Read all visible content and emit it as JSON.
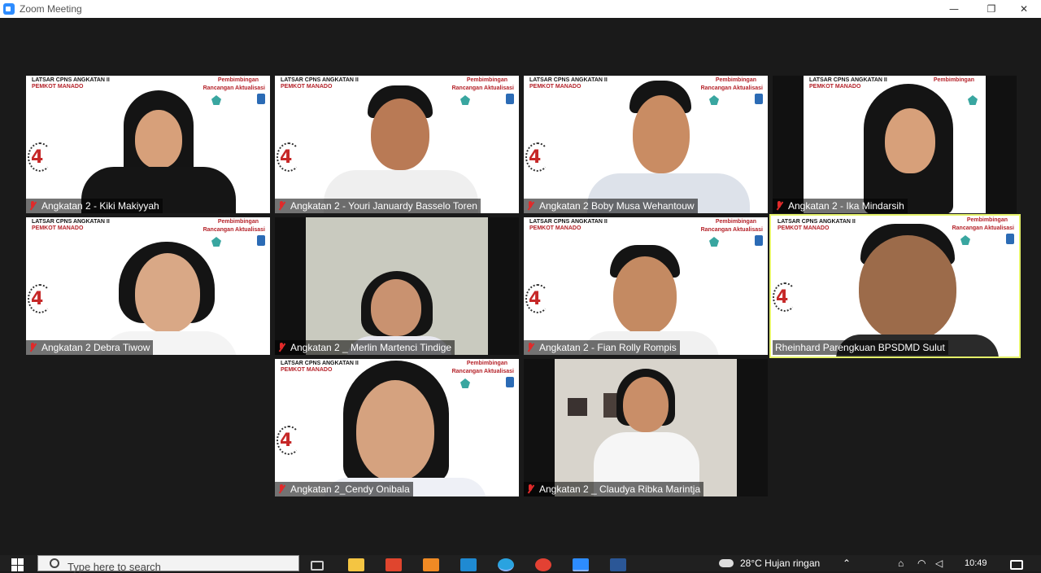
{
  "window": {
    "title": "Zoom Meeting",
    "minimize": "—",
    "maximize": "❐",
    "close": "✕"
  },
  "slide": {
    "header_line1": "LATSAR CPNS ANGKATAN II",
    "header_line2": "PEMKOT MANADO",
    "pembimbingan": "Pembimbingan",
    "rancangan": "Rancangan Aktualisasi",
    "number": "4"
  },
  "participants": [
    {
      "name": "Angkatan 2 - Kiki Makiyyah",
      "muted": true
    },
    {
      "name": "Angkatan 2 - Youri Januardy Basselo Toren",
      "muted": true
    },
    {
      "name": "Angkatan 2 Boby Musa Wehantouw",
      "muted": true
    },
    {
      "name": "Angkatan 2 - Ika Mindarsih",
      "muted": true
    },
    {
      "name": "Angkatan 2 Debra Tiwow",
      "muted": true
    },
    {
      "name": "Angkatan 2 _ Merlin Martenci Tindige",
      "muted": true
    },
    {
      "name": "Angkatan 2 - Fian Rolly Rompis",
      "muted": true
    },
    {
      "name": "Rheinhard Parengkuan BPSDMD Sulut",
      "muted": false,
      "active_speaker": true
    },
    {
      "name": "Angkatan 2_Cendy Onibala",
      "muted": true
    },
    {
      "name": "Angkatan 2 _ Claudya Ribka Marintja",
      "muted": true
    }
  ],
  "taskbar": {
    "search_placeholder": "Type here to search",
    "weather": "28°C  Hujan ringan",
    "time": "10:49",
    "apps": [
      "task-view-icon",
      "file-explorer-icon",
      "app-red-icon",
      "app-orange-icon",
      "vscode-icon",
      "telegram-icon",
      "chrome-icon",
      "zoom-icon",
      "word-icon"
    ]
  },
  "colors": {
    "active_speaker_border": "#e5f26a",
    "muted_icon": "#e02a2a",
    "slide_accent": "#b5232a"
  }
}
